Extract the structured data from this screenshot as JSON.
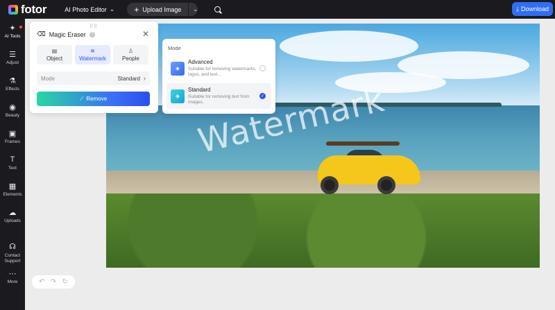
{
  "brand": {
    "name": "fotor"
  },
  "header": {
    "editor_menu": "AI Photo Editor",
    "upload_label": "Upload Image",
    "download_label": "Download"
  },
  "rail": [
    {
      "id": "ai-tools",
      "label": "AI Tools",
      "icon": "magic-wand-icon"
    },
    {
      "id": "adjust",
      "label": "Adjust",
      "icon": "sliders-icon"
    },
    {
      "id": "effects",
      "label": "Effects",
      "icon": "flask-icon"
    },
    {
      "id": "beauty",
      "label": "Beauty",
      "icon": "eye-icon"
    },
    {
      "id": "frames",
      "label": "Frames",
      "icon": "frame-icon"
    },
    {
      "id": "text",
      "label": "Text",
      "icon": "text-icon"
    },
    {
      "id": "elements",
      "label": "Elements",
      "icon": "shapes-icon"
    },
    {
      "id": "uploads",
      "label": "Uploads",
      "icon": "cloud-upload-icon"
    },
    {
      "id": "contact",
      "label": "Contact\nSupport",
      "icon": "headset-icon"
    },
    {
      "id": "more",
      "label": "More",
      "icon": "more-icon"
    }
  ],
  "eraser": {
    "title": "Magic Eraser",
    "tabs": [
      {
        "label": "Object",
        "icon": "object-icon",
        "active": false
      },
      {
        "label": "Watermark",
        "icon": "watermark-icon",
        "active": true
      },
      {
        "label": "People",
        "icon": "person-icon",
        "active": false
      }
    ],
    "mode_label": "Mode",
    "mode_value": "Standard",
    "remove_label": "Remove"
  },
  "mode_menu": {
    "title": "Mode",
    "options": [
      {
        "name": "Advanced",
        "desc": "Suitable for removing watermarks, logos, and text...",
        "selected": false,
        "color": "#5b8bf7"
      },
      {
        "name": "Standard",
        "desc": "Suitable for removing text from images.",
        "selected": true,
        "color": "#22b8d8"
      }
    ]
  },
  "canvas": {
    "watermark_text": "Watermark"
  },
  "colors": {
    "accent": "#2f55f5",
    "download": "#2f6df6",
    "rail_bg": "#1b1b1f"
  }
}
